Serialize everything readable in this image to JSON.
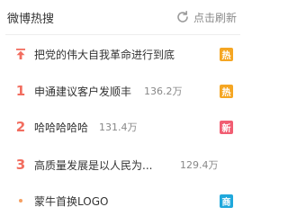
{
  "header": {
    "title": "微博热搜",
    "refresh_label": "点击刷新"
  },
  "colors": {
    "rank_red": "#f26d5f",
    "dot_orange": "#f6a062",
    "badge_hot": "#f5a623",
    "badge_new": "#f15d72",
    "badge_business": "#1fa8dc"
  },
  "items": [
    {
      "rank": "",
      "rank_icon": "pin-up-arrow-icon",
      "topic": "把党的伟大自我革命进行到底",
      "heat": "",
      "badge": "热",
      "badge_type": "hot"
    },
    {
      "rank": "1",
      "topic": "申通建议客户发顺丰",
      "heat": "136.2万",
      "badge": "热",
      "badge_type": "hot"
    },
    {
      "rank": "2",
      "topic": "哈哈哈哈哈",
      "heat": "131.4万",
      "badge": "新",
      "badge_type": "new"
    },
    {
      "rank": "3",
      "topic": "高质量发展是以人民为...",
      "heat": "129.4万",
      "badge": "",
      "badge_type": ""
    },
    {
      "rank": "",
      "rank_icon": "dot-icon",
      "topic": "蒙牛首换LOGO",
      "heat": "",
      "badge": "商",
      "badge_type": "business"
    }
  ]
}
